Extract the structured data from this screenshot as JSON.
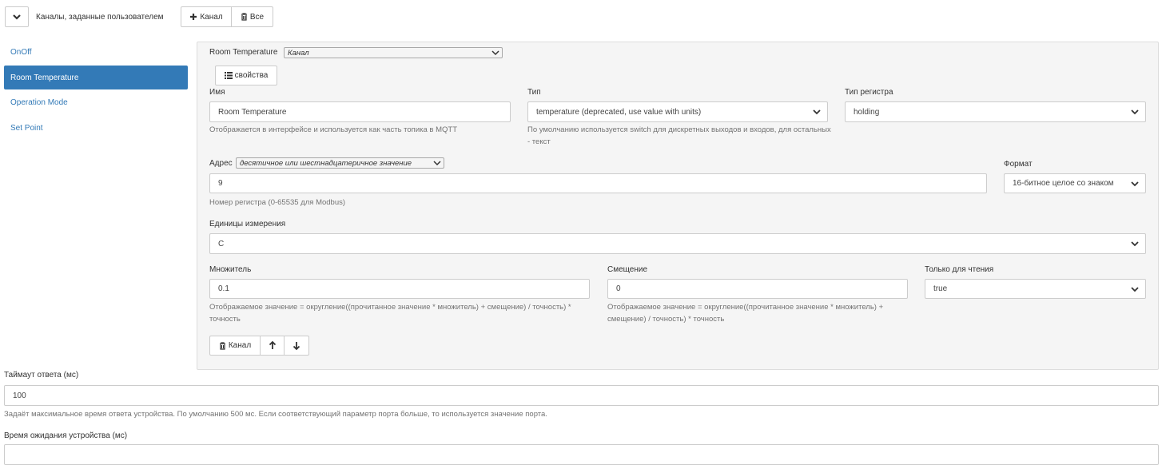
{
  "header": {
    "title": "Каналы, заданные пользователем",
    "add_channel_label": "Канал",
    "delete_all_label": "Все"
  },
  "sidebar": {
    "items": [
      {
        "label": "OnOff",
        "active": false
      },
      {
        "label": "Room Temperature",
        "active": true
      },
      {
        "label": "Operation Mode",
        "active": false
      },
      {
        "label": "Set Point",
        "active": false
      }
    ]
  },
  "channel": {
    "name_title": "Room Temperature",
    "type_select": "Канал",
    "properties_label": "свойства",
    "name": {
      "label": "Имя",
      "value": "Room Temperature",
      "help": "Отображается в интерфейсе и используется как часть топика в MQTT"
    },
    "type": {
      "label": "Тип",
      "value": "temperature (deprecated, use value with units)",
      "help": "По умолчанию используется switch для дискретных выходов и входов, для остальных - текст"
    },
    "reg_type": {
      "label": "Тип регистра",
      "value": "holding"
    },
    "address": {
      "label": "Адрес",
      "mode": "десятичное или шестнадцатеричное значение",
      "value": "9",
      "help": "Номер регистра (0-65535 для Modbus)"
    },
    "format": {
      "label": "Формат",
      "value": "16-битное целое со знаком"
    },
    "units": {
      "label": "Единицы измерения",
      "value": "C"
    },
    "scale": {
      "label": "Множитель",
      "value": "0.1",
      "help": "Отображаемое значение = округление((прочитанное значение * множитель) + смещение) / точность) * точность"
    },
    "offset": {
      "label": "Смещение",
      "value": "0",
      "help": "Отображаемое значение = округление((прочитанное значение * множитель) + смещение) / точность) * точность"
    },
    "readonly": {
      "label": "Только для чтения",
      "value": "true"
    },
    "delete_label": "Канал"
  },
  "response_timeout": {
    "label": "Таймаут ответа (мс)",
    "value": "100",
    "help": "Задаёт максимальное время ответа устройства. По умолчанию 500 мс. Если соответствующий параметр порта больше, то используется значение порта."
  },
  "device_wait": {
    "label": "Время ожидания устройства (мс)"
  }
}
